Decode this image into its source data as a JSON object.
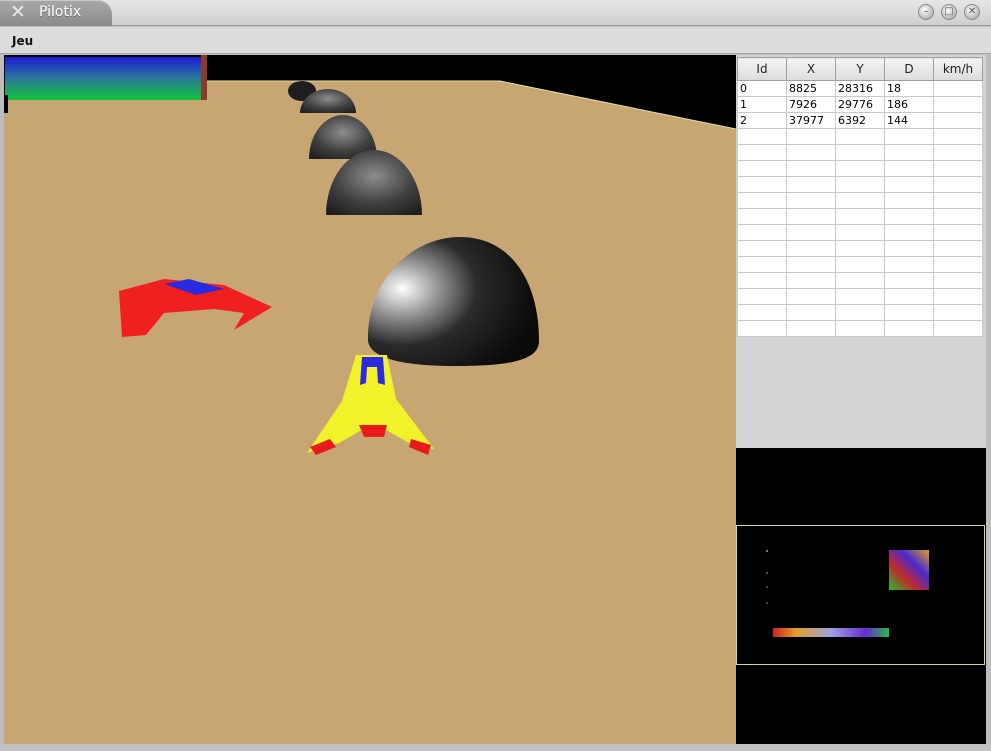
{
  "window": {
    "title": "Pilotix",
    "app_icon": "x-logo-icon",
    "controls": [
      "minimize-icon",
      "maximize-icon",
      "close-icon"
    ]
  },
  "menu": {
    "items": [
      {
        "label": "Jeu"
      }
    ]
  },
  "hud": {
    "energy_bar_colors": [
      "#1b1bd6",
      "#12b23a"
    ]
  },
  "table": {
    "headers": [
      "Id",
      "X",
      "Y",
      "D",
      "km/h"
    ],
    "rows": [
      [
        "0",
        "8825",
        "28316",
        "18",
        ""
      ],
      [
        "1",
        "7926",
        "29776",
        "186",
        ""
      ],
      [
        "2",
        "37977",
        "6392",
        "144",
        ""
      ]
    ],
    "empty_rows": 13
  },
  "colors": {
    "ground": "#c8a674",
    "player_ship": "#f2f22a",
    "enemy_ship": "#f02020",
    "ship_canopy": "#2a2ae0"
  }
}
